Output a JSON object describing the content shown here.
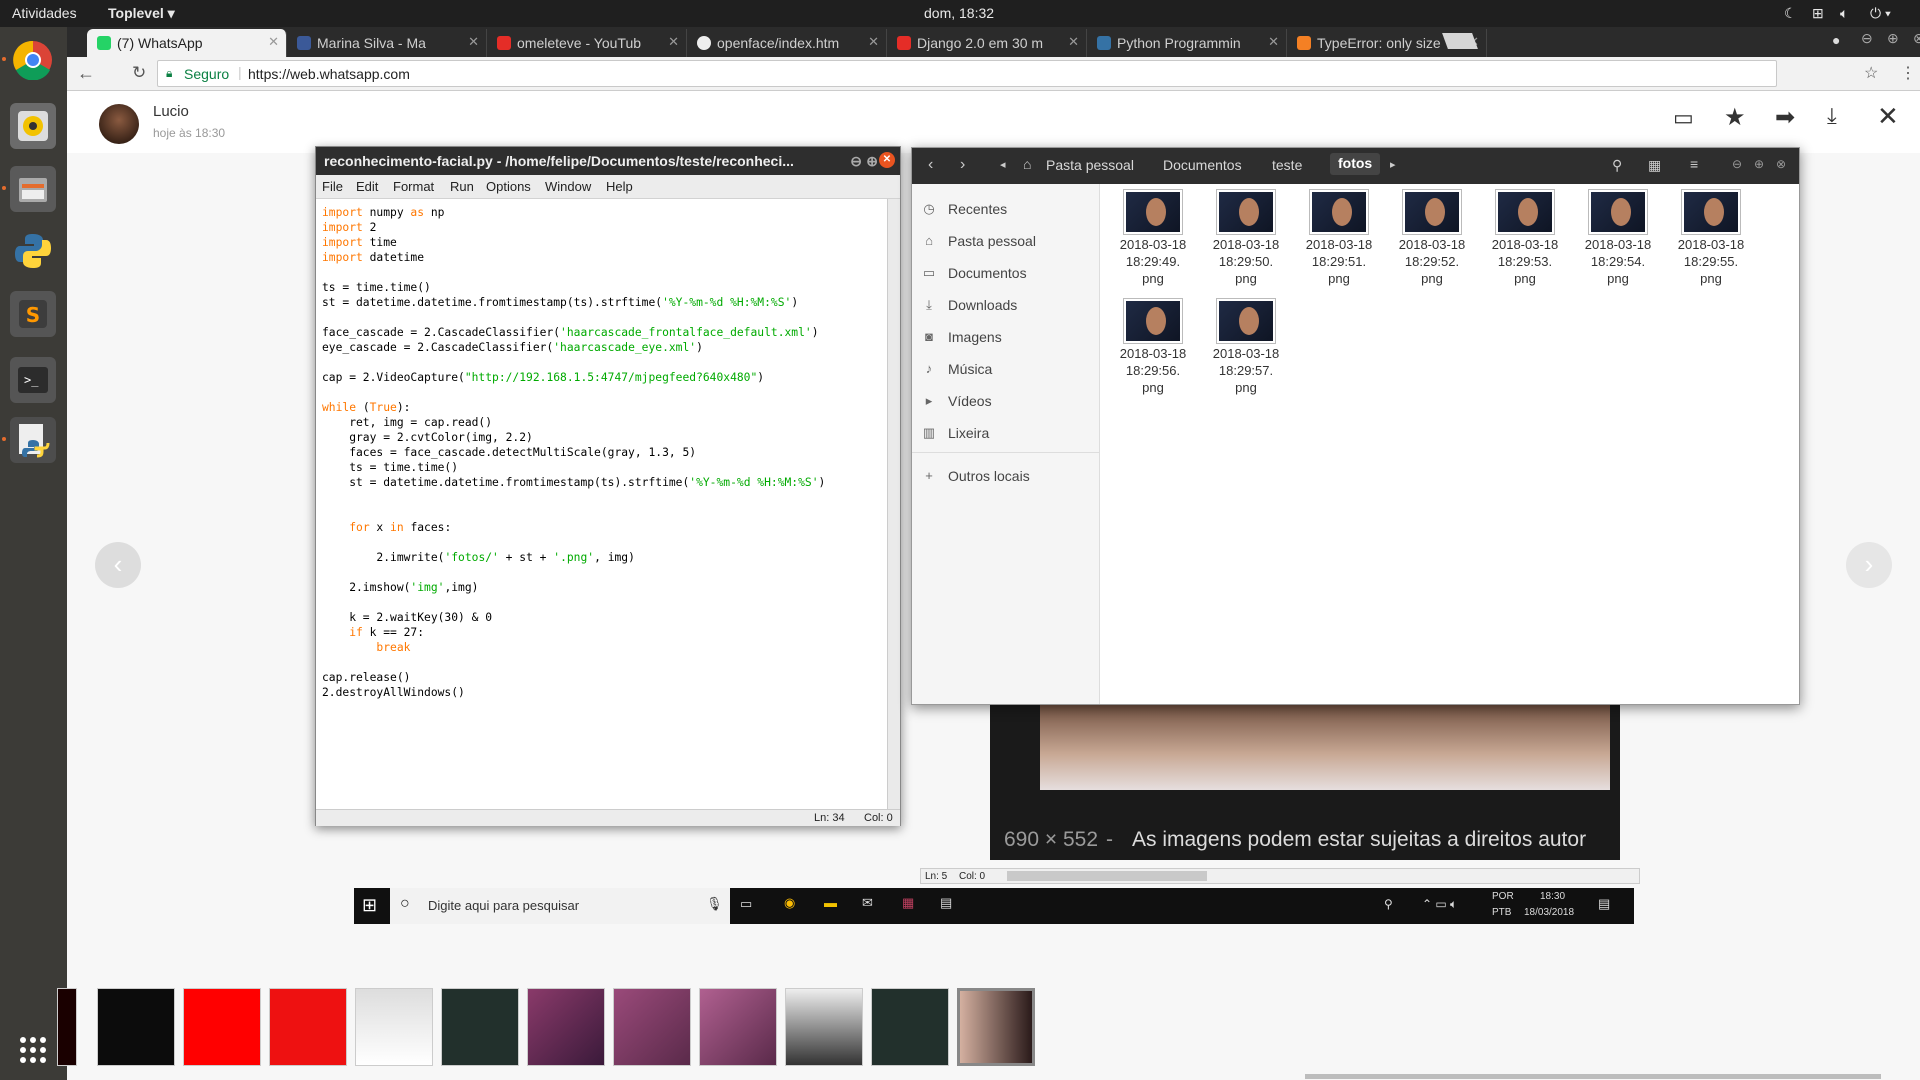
{
  "topbar": {
    "activities": "Atividades",
    "app": "Toplevel",
    "clock": "dom, 18:32"
  },
  "launcher": [
    "chrome-icon",
    "rhythmbox-icon",
    "files-icon",
    "python-icon",
    "sublime-icon",
    "terminal-icon",
    "idle-icon",
    "apps-grid-icon"
  ],
  "browser": {
    "tabs": [
      {
        "label": "(7) WhatsApp",
        "icon": "whatsapp-icon",
        "color": "#25d366"
      },
      {
        "label": "Marina Silva - Ma",
        "icon": "facebook-icon",
        "color": "#3b5998"
      },
      {
        "label": "omeleteve - YouTub",
        "icon": "youtube-icon",
        "color": "#e52d27"
      },
      {
        "label": "openface/index.htm",
        "icon": "github-icon",
        "color": "#222222"
      },
      {
        "label": "Django 2.0 em 30 m",
        "icon": "youtube-icon",
        "color": "#e52d27"
      },
      {
        "label": "Python Programmin",
        "icon": "python-icon",
        "color": "#3572a5"
      },
      {
        "label": "TypeError: only size",
        "icon": "stackoverflow-icon",
        "color": "#f48024"
      }
    ],
    "secure_label": "Seguro",
    "url": "https://web.whatsapp.com"
  },
  "whatsapp": {
    "contact": "Lucio",
    "time": "hoje às 18:30"
  },
  "idle": {
    "title": "reconhecimento-facial.py - /home/felipe/Documentos/teste/reconheci...",
    "menu": [
      "File",
      "Edit",
      "Format",
      "Run",
      "Options",
      "Window",
      "Help"
    ],
    "code": [
      "import numpy as np",
      "import cv2",
      "import time",
      "import datetime",
      "",
      "ts = time.time()",
      "st = datetime.datetime.fromtimestamp(ts).strftime('%Y-%m-%d %H:%M:%S')",
      "",
      "face_cascade = cv2.CascadeClassifier('haarcascade_frontalface_default.xml')",
      "eye_cascade = cv2.CascadeClassifier('haarcascade_eye.xml')",
      "",
      "cap = cv2.VideoCapture(\"http://192.168.1.5:4747/mjpegfeed?640x480\")",
      "",
      "while (True):",
      "    ret, img = cap.read()",
      "    gray = cv2.cvtColor(img, cv2.COLOR_BGR2GRAY)",
      "    faces = face_cascade.detectMultiScale(gray, 1.3, 5)",
      "    ts = time.time()",
      "    st = datetime.datetime.fromtimestamp(ts).strftime('%Y-%m-%d %H:%M:%S')",
      "",
      "",
      "    for x in faces:",
      "",
      "        cv2.imwrite('fotos/' + st + '.png', img)",
      "",
      "    cv2.imshow('img',img)",
      "",
      "    k = cv2.waitKey(30) & 0xff",
      "    if k == 27:",
      "        break",
      "",
      "cap.release()",
      "cv2.destroyAllWindows()"
    ],
    "status": {
      "line": "Ln: 34",
      "col": "Col: 0"
    }
  },
  "nautilus": {
    "path": [
      "Pasta pessoal",
      "Documentos",
      "teste",
      "fotos"
    ],
    "sidebar": [
      {
        "label": "Recentes",
        "icon": "clock-icon"
      },
      {
        "label": "Pasta pessoal",
        "icon": "home-icon"
      },
      {
        "label": "Documentos",
        "icon": "document-icon"
      },
      {
        "label": "Downloads",
        "icon": "download-icon"
      },
      {
        "label": "Imagens",
        "icon": "camera-icon"
      },
      {
        "label": "Música",
        "icon": "music-icon"
      },
      {
        "label": "Vídeos",
        "icon": "video-icon"
      },
      {
        "label": "Lixeira",
        "icon": "trash-icon"
      },
      {
        "label": "Outros locais",
        "icon": "plus-icon"
      }
    ],
    "files": [
      [
        "2018-03-18",
        "18:29:49.",
        "png"
      ],
      [
        "2018-03-18",
        "18:29:50.",
        "png"
      ],
      [
        "2018-03-18",
        "18:29:51.",
        "png"
      ],
      [
        "2018-03-18",
        "18:29:52.",
        "png"
      ],
      [
        "2018-03-18",
        "18:29:53.",
        "png"
      ],
      [
        "2018-03-18",
        "18:29:54.",
        "png"
      ],
      [
        "2018-03-18",
        "18:29:55.",
        "png"
      ],
      [
        "2018-03-18",
        "18:29:56.",
        "png"
      ],
      [
        "2018-03-18",
        "18:29:57.",
        "png"
      ]
    ]
  },
  "bg_image": {
    "caption_size": "690 × 552",
    "caption": "As imagens podem estar sujeitas a direitos autor"
  },
  "bg_status": {
    "line": "Ln: 5",
    "col": "Col: 0"
  },
  "windows_taskbar": {
    "search": "Digite aqui para pesquisar",
    "lang1": "POR",
    "lang2": "PTB",
    "time": "18:30",
    "date": "18/03/2018"
  }
}
